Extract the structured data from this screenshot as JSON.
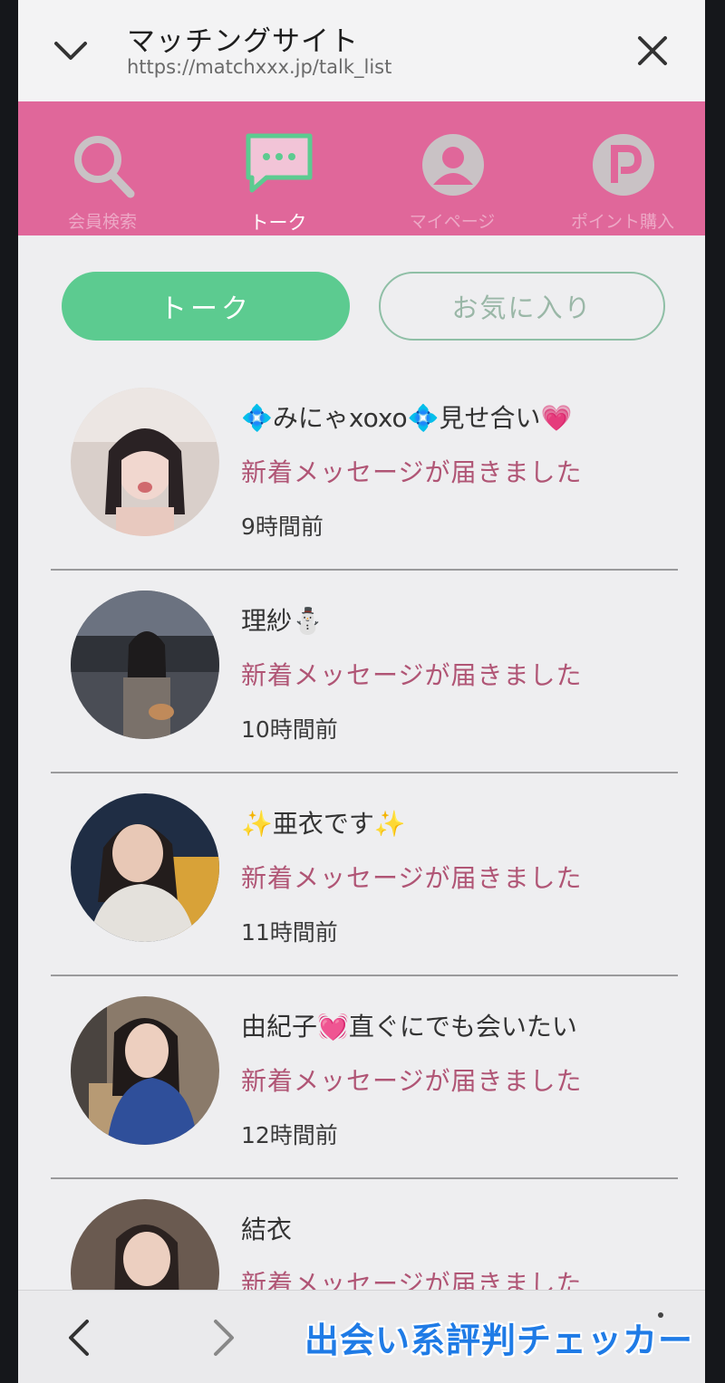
{
  "browser": {
    "title": "マッチングサイト",
    "url": "https://matchxxx.jp/talk_list"
  },
  "nav": {
    "items": [
      {
        "label": "会員検索",
        "icon": "search-icon"
      },
      {
        "label": "トーク",
        "icon": "chat-bubble-icon",
        "active": true
      },
      {
        "label": "マイページ",
        "icon": "profile-icon"
      },
      {
        "label": "ポイント購入",
        "icon": "points-icon"
      }
    ]
  },
  "tabs": {
    "talk": "トーク",
    "favorites": "お気に入り"
  },
  "talks": [
    {
      "name": "💠みにゃxoxo💠見せ合い💗",
      "message": "新着メッセージが届きました",
      "time": "9時間前"
    },
    {
      "name": "理紗⛄",
      "message": "新着メッセージが届きました",
      "time": "10時間前"
    },
    {
      "name": "✨亜衣です✨",
      "message": "新着メッセージが届きました",
      "time": "11時間前"
    },
    {
      "name": "由紀子💓直ぐにでも会いたい",
      "message": "新着メッセージが届きました",
      "time": "12時間前"
    },
    {
      "name": "結衣",
      "message": "新着メッセージが届きました",
      "time": ""
    }
  ],
  "watermark": "出会い系評判チェッカー",
  "colors": {
    "nav_pink": "#e0679a",
    "accent_green": "#5ccb90",
    "message_pink": "#b05575"
  }
}
